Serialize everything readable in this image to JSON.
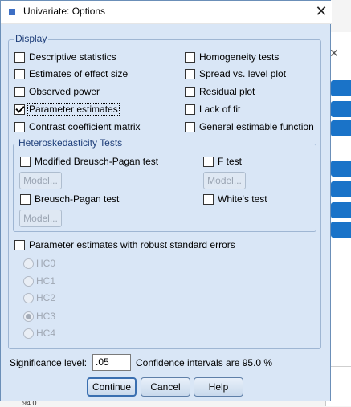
{
  "window": {
    "title": "Univariate: Options"
  },
  "display": {
    "legend": "Display",
    "left": [
      {
        "label": "Descriptive statistics",
        "checked": false
      },
      {
        "label": "Estimates of effect size",
        "checked": false
      },
      {
        "label": "Observed power",
        "checked": false
      },
      {
        "label": "Parameter estimates",
        "checked": true
      },
      {
        "label": "Contrast coefficient matrix",
        "checked": false
      }
    ],
    "right": [
      {
        "label": "Homogeneity tests",
        "checked": false
      },
      {
        "label": "Spread vs. level plot",
        "checked": false
      },
      {
        "label": "Residual plot",
        "checked": false
      },
      {
        "label": "Lack of fit",
        "checked": false
      },
      {
        "label": "General estimable function",
        "checked": false
      }
    ]
  },
  "hetero": {
    "legend": "Heteroskedasticity Tests",
    "modified_bp": "Modified Breusch-Pagan test",
    "f_test": "F test",
    "bp": "Breusch-Pagan test",
    "whites": "White's test",
    "model_button": "Model..."
  },
  "robust": {
    "label": "Parameter estimates with robust standard errors",
    "options": [
      "HC0",
      "HC1",
      "HC2",
      "HC3",
      "HC4"
    ],
    "selected": "HC3"
  },
  "footer": {
    "significance_label": "Significance level:",
    "significance_value": ".05",
    "confidence_text": "Confidence intervals are 95.0 %"
  },
  "buttons": {
    "continue": "Continue",
    "cancel": "Cancel",
    "help": "Help"
  },
  "background": {
    "row_number": "94.0"
  }
}
